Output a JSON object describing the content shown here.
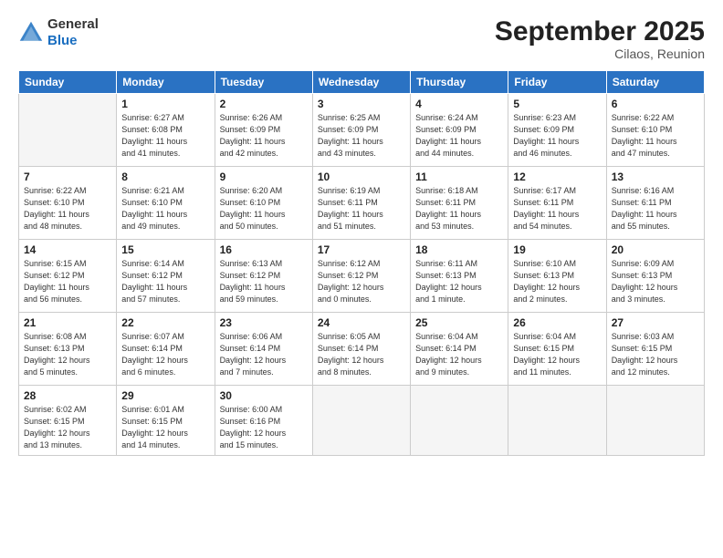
{
  "header": {
    "logo_line1": "General",
    "logo_line2": "Blue",
    "month": "September 2025",
    "location": "Cilaos, Reunion"
  },
  "weekdays": [
    "Sunday",
    "Monday",
    "Tuesday",
    "Wednesday",
    "Thursday",
    "Friday",
    "Saturday"
  ],
  "weeks": [
    [
      {
        "day": "",
        "info": ""
      },
      {
        "day": "1",
        "info": "Sunrise: 6:27 AM\nSunset: 6:08 PM\nDaylight: 11 hours\nand 41 minutes."
      },
      {
        "day": "2",
        "info": "Sunrise: 6:26 AM\nSunset: 6:09 PM\nDaylight: 11 hours\nand 42 minutes."
      },
      {
        "day": "3",
        "info": "Sunrise: 6:25 AM\nSunset: 6:09 PM\nDaylight: 11 hours\nand 43 minutes."
      },
      {
        "day": "4",
        "info": "Sunrise: 6:24 AM\nSunset: 6:09 PM\nDaylight: 11 hours\nand 44 minutes."
      },
      {
        "day": "5",
        "info": "Sunrise: 6:23 AM\nSunset: 6:09 PM\nDaylight: 11 hours\nand 46 minutes."
      },
      {
        "day": "6",
        "info": "Sunrise: 6:22 AM\nSunset: 6:10 PM\nDaylight: 11 hours\nand 47 minutes."
      }
    ],
    [
      {
        "day": "7",
        "info": "Sunrise: 6:22 AM\nSunset: 6:10 PM\nDaylight: 11 hours\nand 48 minutes."
      },
      {
        "day": "8",
        "info": "Sunrise: 6:21 AM\nSunset: 6:10 PM\nDaylight: 11 hours\nand 49 minutes."
      },
      {
        "day": "9",
        "info": "Sunrise: 6:20 AM\nSunset: 6:10 PM\nDaylight: 11 hours\nand 50 minutes."
      },
      {
        "day": "10",
        "info": "Sunrise: 6:19 AM\nSunset: 6:11 PM\nDaylight: 11 hours\nand 51 minutes."
      },
      {
        "day": "11",
        "info": "Sunrise: 6:18 AM\nSunset: 6:11 PM\nDaylight: 11 hours\nand 53 minutes."
      },
      {
        "day": "12",
        "info": "Sunrise: 6:17 AM\nSunset: 6:11 PM\nDaylight: 11 hours\nand 54 minutes."
      },
      {
        "day": "13",
        "info": "Sunrise: 6:16 AM\nSunset: 6:11 PM\nDaylight: 11 hours\nand 55 minutes."
      }
    ],
    [
      {
        "day": "14",
        "info": "Sunrise: 6:15 AM\nSunset: 6:12 PM\nDaylight: 11 hours\nand 56 minutes."
      },
      {
        "day": "15",
        "info": "Sunrise: 6:14 AM\nSunset: 6:12 PM\nDaylight: 11 hours\nand 57 minutes."
      },
      {
        "day": "16",
        "info": "Sunrise: 6:13 AM\nSunset: 6:12 PM\nDaylight: 11 hours\nand 59 minutes."
      },
      {
        "day": "17",
        "info": "Sunrise: 6:12 AM\nSunset: 6:12 PM\nDaylight: 12 hours\nand 0 minutes."
      },
      {
        "day": "18",
        "info": "Sunrise: 6:11 AM\nSunset: 6:13 PM\nDaylight: 12 hours\nand 1 minute."
      },
      {
        "day": "19",
        "info": "Sunrise: 6:10 AM\nSunset: 6:13 PM\nDaylight: 12 hours\nand 2 minutes."
      },
      {
        "day": "20",
        "info": "Sunrise: 6:09 AM\nSunset: 6:13 PM\nDaylight: 12 hours\nand 3 minutes."
      }
    ],
    [
      {
        "day": "21",
        "info": "Sunrise: 6:08 AM\nSunset: 6:13 PM\nDaylight: 12 hours\nand 5 minutes."
      },
      {
        "day": "22",
        "info": "Sunrise: 6:07 AM\nSunset: 6:14 PM\nDaylight: 12 hours\nand 6 minutes."
      },
      {
        "day": "23",
        "info": "Sunrise: 6:06 AM\nSunset: 6:14 PM\nDaylight: 12 hours\nand 7 minutes."
      },
      {
        "day": "24",
        "info": "Sunrise: 6:05 AM\nSunset: 6:14 PM\nDaylight: 12 hours\nand 8 minutes."
      },
      {
        "day": "25",
        "info": "Sunrise: 6:04 AM\nSunset: 6:14 PM\nDaylight: 12 hours\nand 9 minutes."
      },
      {
        "day": "26",
        "info": "Sunrise: 6:04 AM\nSunset: 6:15 PM\nDaylight: 12 hours\nand 11 minutes."
      },
      {
        "day": "27",
        "info": "Sunrise: 6:03 AM\nSunset: 6:15 PM\nDaylight: 12 hours\nand 12 minutes."
      }
    ],
    [
      {
        "day": "28",
        "info": "Sunrise: 6:02 AM\nSunset: 6:15 PM\nDaylight: 12 hours\nand 13 minutes."
      },
      {
        "day": "29",
        "info": "Sunrise: 6:01 AM\nSunset: 6:15 PM\nDaylight: 12 hours\nand 14 minutes."
      },
      {
        "day": "30",
        "info": "Sunrise: 6:00 AM\nSunset: 6:16 PM\nDaylight: 12 hours\nand 15 minutes."
      },
      {
        "day": "",
        "info": ""
      },
      {
        "day": "",
        "info": ""
      },
      {
        "day": "",
        "info": ""
      },
      {
        "day": "",
        "info": ""
      }
    ]
  ]
}
